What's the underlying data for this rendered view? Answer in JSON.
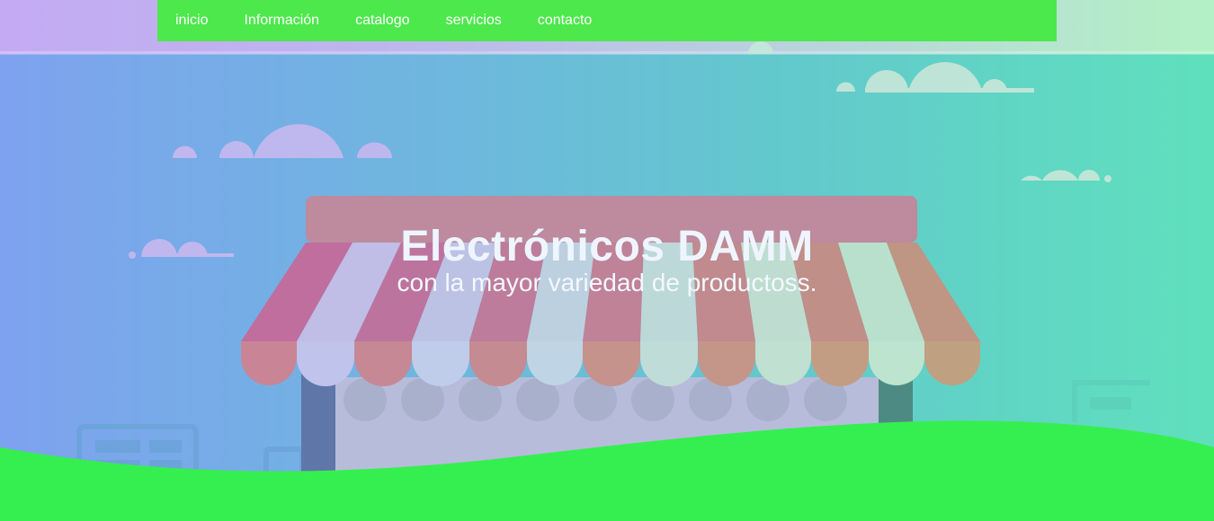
{
  "nav": {
    "items": [
      {
        "label": "inicio"
      },
      {
        "label": "Información"
      },
      {
        "label": "catalogo"
      },
      {
        "label": "servicios"
      },
      {
        "label": "contacto"
      }
    ]
  },
  "hero": {
    "title": "Electrónicos DAMM",
    "subtitle": "con la mayor variedad de productoss."
  },
  "colors": {
    "nav_bg": "#4de84c",
    "wave": "#35ef50"
  }
}
